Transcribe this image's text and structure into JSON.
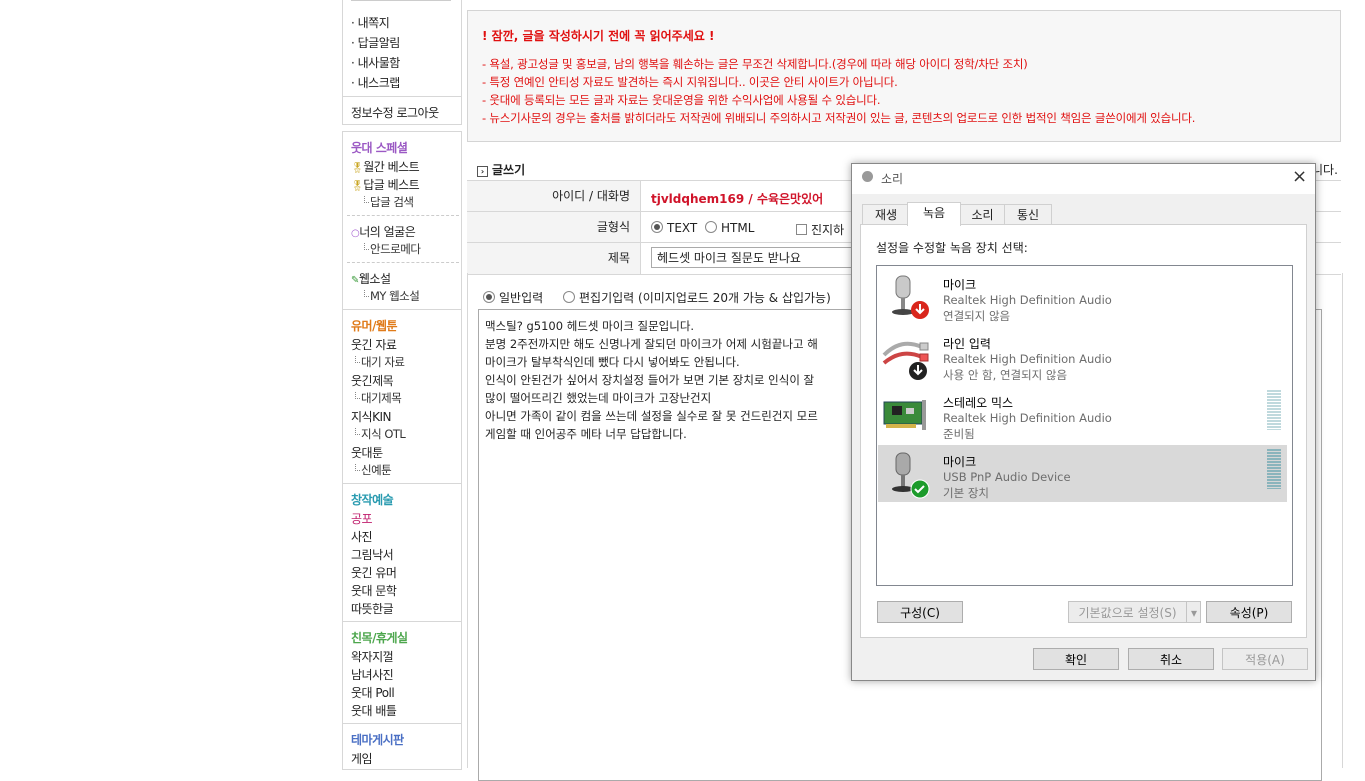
{
  "sidebar": {
    "top_items": [
      "내쪽지",
      "답글알림",
      "내사물함",
      "내스크랩"
    ],
    "account_links": "정보수정 로그아웃",
    "special_title": "웃대 스페셜",
    "monthly_best": "월간 베스트",
    "reply_best": "답글 베스트",
    "reply_search": "답글 검색",
    "your_face": "너의 얼굴은",
    "andromeda": "안드로메다",
    "web_novel": "웹소설",
    "my_web_novel": "MY 웹소설",
    "humor_title": "유머/웹툰",
    "funny_data": "웃긴 자료",
    "waiting_data": "대기 자료",
    "funny_title": "웃긴제목",
    "waiting_title": "대기제목",
    "kin": "지식KIN",
    "otl": "지식 OTL",
    "webtoon": "웃대툰",
    "new_webtoon": "신예툰",
    "art_title": "창작예술",
    "horror": "공포",
    "photo": "사진",
    "doodle": "그림낙서",
    "funny_humor": "웃긴 유머",
    "literature": "웃대 문학",
    "warm": "따뜻한글",
    "friend_title": "친목/휴게실",
    "noisy": "왁자지껄",
    "couple_photo": "남녀사진",
    "poll": "웃대 Poll",
    "battle": "웃대 배틀",
    "theme_title": "테마게시판",
    "game": "게임"
  },
  "notice": {
    "title": "! 잠깐, 글을 작성하시기 전에 꼭 읽어주세요 !",
    "lines": [
      "- 욕설, 광고성글 및 홍보글, 남의 행복을 훼손하는 글은 무조건 삭제합니다.(경우에 따라 해당 아이디 정학/차단 조치)",
      "- 특정 연예인 안티성 자료도 발견하는 즉시 지워집니다.. 이곳은 안티 사이트가 아닙니다.",
      "- 웃대에 등록되는 모든 글과 자료는 웃대운영을 위한 수익사업에 사용될 수 있습니다.",
      "- 뉴스기사문의 경우는 출처를 밝히더라도 저작권에 위배되니 주의하시고 저작권이 있는 글, 콘텐츠의 업로드로 인한 법적인 책임은 글쓴이에게 있습니다."
    ]
  },
  "write": {
    "heading": "글쓰기",
    "right_fragment": "니다.",
    "id_label": "아이디 / 대화명",
    "id_value": "tjvldqhem169 / 수육은맛있어",
    "format_label": "글형식",
    "format_text": "TEXT",
    "format_html": "HTML",
    "serious_label": "진지하",
    "title_label": "제목",
    "title_value": "헤드셋 마이크 질문도 받나요",
    "mode_normal": "일반입력",
    "mode_editor": "편집기입력 (이미지업로드 20개 가능 & 삽입가능)",
    "body_lines": [
      "맥스틸?  g5100 헤드셋 마이크 질문입니다.",
      "분명 2주전까지만 해도 신명나게 잘되던 마이크가 어제 시험끝나고 해",
      "마이크가 탈부착식인데 뺐다 다시 넣어봐도 안됩니다.",
      "인식이 안된건가 싶어서 장치설정 들어가 보면 기본 장치로 인식이 잘",
      "많이 떨어뜨리긴 했었는데 마이크가 고장난건지",
      "아니면 가족이 같이 컴을 쓰는데 설정을 실수로 잘 못 건드린건지 모르",
      "게임할 때 인어공주 메타 너무 답답합니다."
    ]
  },
  "dialog": {
    "title": "소리",
    "tabs": [
      "재생",
      "녹음",
      "소리",
      "통신"
    ],
    "active_tab": "녹음",
    "instruction": "설정을 수정할 녹음 장치 선택:",
    "devices": [
      {
        "name": "마이크",
        "driver": "Realtek High Definition Audio",
        "status": "연결되지 않음",
        "icon": "microphone-disconnected-icon"
      },
      {
        "name": "라인 입력",
        "driver": "Realtek High Definition Audio",
        "status": "사용 안 함, 연결되지 않음",
        "icon": "line-in-cable-icon"
      },
      {
        "name": "스테레오 믹스",
        "driver": "Realtek High Definition Audio",
        "status": "준비됨",
        "icon": "sound-card-icon"
      },
      {
        "name": "마이크",
        "driver": "USB PnP Audio Device",
        "status": "기본 장치",
        "icon": "microphone-default-icon"
      }
    ],
    "configure": "구성(C)",
    "set_default": "기본값으로 설정(S)",
    "properties": "속성(P)",
    "ok": "확인",
    "cancel": "취소",
    "apply": "적용(A)",
    "colors": {
      "selected_row": "#d9d9d9",
      "error_red": "#d9261c",
      "success_green": "#1c9b2b"
    }
  }
}
